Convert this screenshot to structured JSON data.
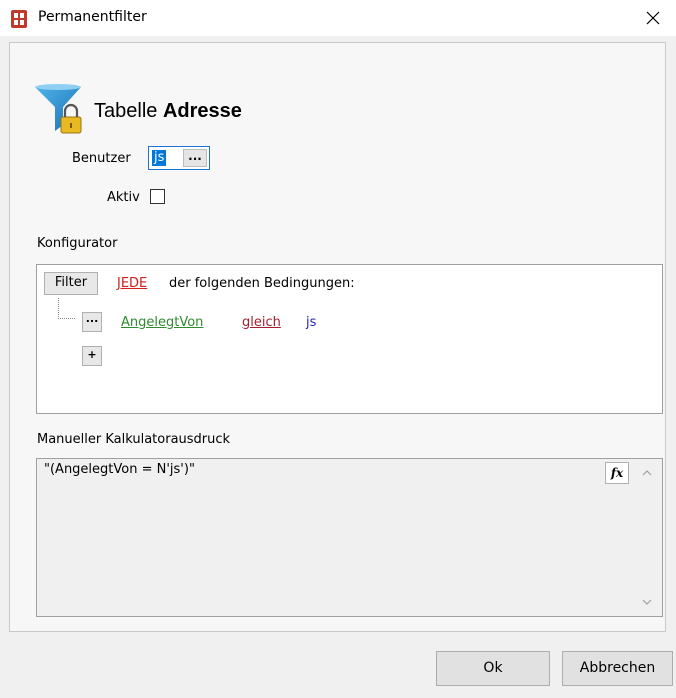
{
  "window": {
    "title": "Permanentfilter",
    "close_glyph": "✕"
  },
  "header": {
    "table_prefix": "Tabelle",
    "table_name": "Adresse",
    "icon": "funnel-lock-icon"
  },
  "form": {
    "user_label": "Benutzer",
    "user_value": "js",
    "user_lookup_label": "...",
    "active_label": "Aktiv",
    "active_checked": false
  },
  "configurator": {
    "label": "Konfigurator",
    "filter_button": "Filter",
    "quantifier": "JEDE",
    "quantifier_rest": "der folgenden Bedingungen:",
    "condition": {
      "menu_button": "...",
      "field": "AngelegtVon",
      "operator": "gleich",
      "value": "js"
    },
    "add_button": "+"
  },
  "expression": {
    "label": "Manueller Kalkulatorausdruck",
    "value": "\"(AngelegtVon = N'js')\"",
    "fx_button": "fx"
  },
  "buttons": {
    "ok": "Ok",
    "cancel": "Abbrechen"
  },
  "colors": {
    "accent": "#0078d7",
    "quantifier": "#d01f1f",
    "field": "#2e8b2e",
    "operator": "#a0202e",
    "value": "#2424b8"
  }
}
